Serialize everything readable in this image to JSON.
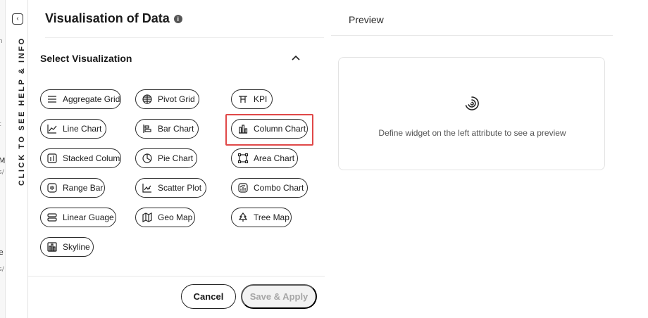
{
  "peek": {
    "chars": [
      "n",
      "t",
      "M",
      "s/",
      "e",
      "s/"
    ]
  },
  "help_rail": {
    "label": "CLICK TO SEE HELP & INFO",
    "toggle_icon": "collapse-left-icon"
  },
  "panel": {
    "title": "Visualisation of Data",
    "info_glyph": "i",
    "section_title": "Select Visualization",
    "collapse_icon": "chevron-up-icon"
  },
  "visualizations": [
    {
      "id": "aggregate-grid",
      "label": "Aggregate Grid",
      "icon": "lines-icon"
    },
    {
      "id": "pivot-grid",
      "label": "Pivot Grid",
      "icon": "grid-icon"
    },
    {
      "id": "kpi",
      "label": "KPI",
      "icon": "kpi-icon"
    },
    {
      "id": "line-chart",
      "label": "Line Chart",
      "icon": "line-chart-icon"
    },
    {
      "id": "bar-chart",
      "label": "Bar Chart",
      "icon": "bar-chart-icon"
    },
    {
      "id": "column-chart",
      "label": "Column Chart",
      "icon": "column-chart-icon",
      "selected": true
    },
    {
      "id": "stacked-column",
      "label": "Stacked Column",
      "icon": "stacked-column-icon"
    },
    {
      "id": "pie-chart",
      "label": "Pie Chart",
      "icon": "pie-chart-icon"
    },
    {
      "id": "area-chart",
      "label": "Area Chart",
      "icon": "area-chart-icon"
    },
    {
      "id": "range-bar",
      "label": "Range Bar",
      "icon": "range-bar-icon"
    },
    {
      "id": "scatter-plot",
      "label": "Scatter Plot",
      "icon": "scatter-plot-icon"
    },
    {
      "id": "combo-chart",
      "label": "Combo Chart",
      "icon": "combo-chart-icon"
    },
    {
      "id": "linear-guage",
      "label": "Linear Guage",
      "icon": "linear-gauge-icon"
    },
    {
      "id": "geo-map",
      "label": "Geo Map",
      "icon": "map-icon"
    },
    {
      "id": "tree-map",
      "label": "Tree Map",
      "icon": "tree-icon"
    },
    {
      "id": "skyline",
      "label": "Skyline",
      "icon": "skyline-icon"
    }
  ],
  "footer": {
    "cancel_label": "Cancel",
    "save_label": "Save & Apply"
  },
  "preview": {
    "label": "Preview",
    "hint": "Define widget on the left attribute to see a preview",
    "spinner_icon": "loading-spinner-icon"
  },
  "colors": {
    "highlight": "#e04848",
    "text": "#1f1f1f",
    "disabled_text": "#a6a6a6",
    "border": "#2a2a2a"
  }
}
